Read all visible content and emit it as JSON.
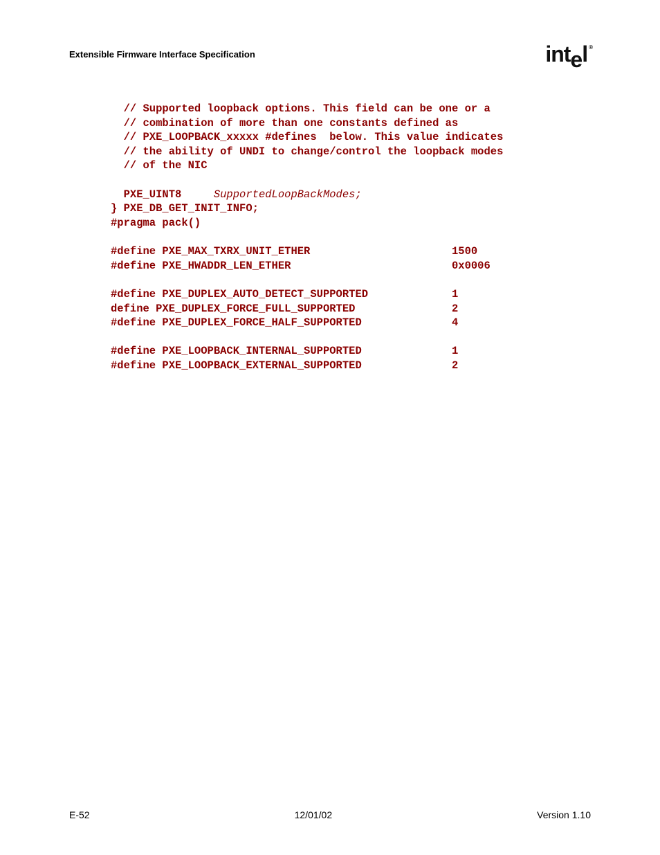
{
  "header": {
    "title": "Extensible Firmware Interface Specification",
    "logo_text_1": "int",
    "logo_text_2": "e",
    "logo_text_3": "l",
    "logo_reg": "®"
  },
  "code": {
    "c1": "  // Supported loopback options. This field can be one or a",
    "c2": "  // combination of more than one constants defined as",
    "c3": "  // PXE_LOOPBACK_xxxxx #defines  below. This value indicates",
    "c4": "  // the ability of UNDI to change/control the loopback modes",
    "c5": "  // of the NIC",
    "blank1": " ",
    "l_type": "  PXE_UINT8     ",
    "l_var": "SupportedLoopBackModes;",
    "close": "} PXE_DB_GET_INIT_INFO;",
    "pragma": "#pragma pack()",
    "blank2": " ",
    "d1": "#define PXE_MAX_TXRX_UNIT_ETHER                      1500",
    "d2": "#define PXE_HWADDR_LEN_ETHER                         0x0006",
    "blank3": " ",
    "d3": "#define PXE_DUPLEX_AUTO_DETECT_SUPPORTED             1",
    "d4": "define PXE_DUPLEX_FORCE_FULL_SUPPORTED               2",
    "d5": "#define PXE_DUPLEX_FORCE_HALF_SUPPORTED              4",
    "blank4": " ",
    "d6": "#define PXE_LOOPBACK_INTERNAL_SUPPORTED              1",
    "d7": "#define PXE_LOOPBACK_EXTERNAL_SUPPORTED              2"
  },
  "footer": {
    "left": "E-52",
    "center": "12/01/02",
    "right": "Version 1.10"
  }
}
